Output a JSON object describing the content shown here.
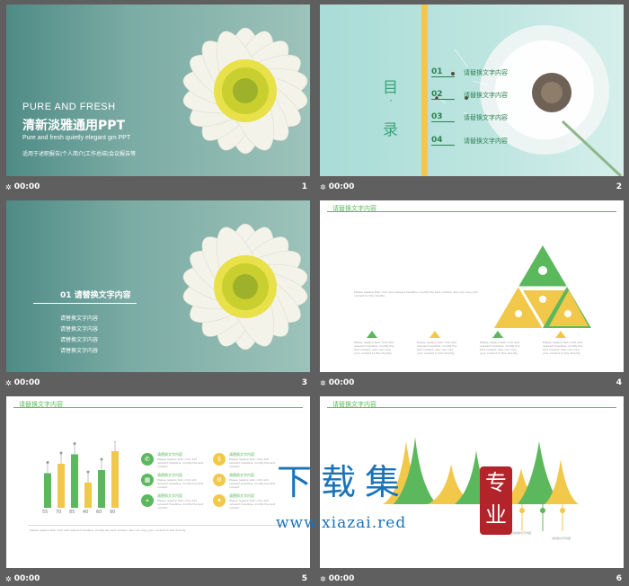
{
  "thumbs": [
    {
      "time": "00:00",
      "num": "1"
    },
    {
      "time": "00:00",
      "num": "2"
    },
    {
      "time": "00:00",
      "num": "3"
    },
    {
      "time": "00:00",
      "num": "4"
    },
    {
      "time": "00:00",
      "num": "5"
    },
    {
      "time": "00:00",
      "num": "6"
    }
  ],
  "slide1": {
    "line1": "PURE AND FRESH",
    "line2": "清新淡雅通用PPT",
    "line3": "Pure and fresh quietly elegant gm PPT",
    "line4": "适用于述职报告|个人简介|工作总结|会议报告等"
  },
  "slide2": {
    "toc_a": "目",
    "toc_b": "·",
    "toc_c": "录",
    "items": [
      {
        "n": "01",
        "l": "请替换文字内容"
      },
      {
        "n": "02",
        "l": "请替换文字内容"
      },
      {
        "n": "03",
        "l": "请替换文字内容"
      },
      {
        "n": "04",
        "l": "请替换文字内容"
      }
    ]
  },
  "slide3": {
    "heading": "01 请替换文字内容",
    "items": [
      "请替换文字内容",
      "请替换文字内容",
      "请替换文字内容",
      "请替换文字内容"
    ]
  },
  "slide4": {
    "header": "请替换文字内容",
    "para": "Please replace text, click add relevant headline, modify the text content, also can copy your content to this directly.",
    "small": "Please replace text, click add relevant headline, modify the text content, also can copy your content to this directly."
  },
  "slide5": {
    "header": "请替换文字内容",
    "bars": [
      {
        "label": "55",
        "value": 55
      },
      {
        "label": "70",
        "value": 70
      },
      {
        "label": "85",
        "value": 85
      },
      {
        "label": "40",
        "value": 40
      },
      {
        "label": "60",
        "value": 60
      },
      {
        "label": "90",
        "value": 90
      }
    ],
    "card_title": "请替换文字内容",
    "card_text": "Please replace text, click add relevant headline, modify the text content",
    "footer": "Please replace text, click add relevant headline, modify the text content, also can copy your content to this directly."
  },
  "slide6": {
    "header": "请替换文字内容",
    "cap": "请替换文字内容"
  },
  "watermark": {
    "big": "下载集",
    "url": "www.xiazai.red",
    "stamp": "专业"
  },
  "colors": {
    "green": "#5cb85c",
    "yellow": "#f1c84a",
    "teal": "#7aaba4"
  }
}
